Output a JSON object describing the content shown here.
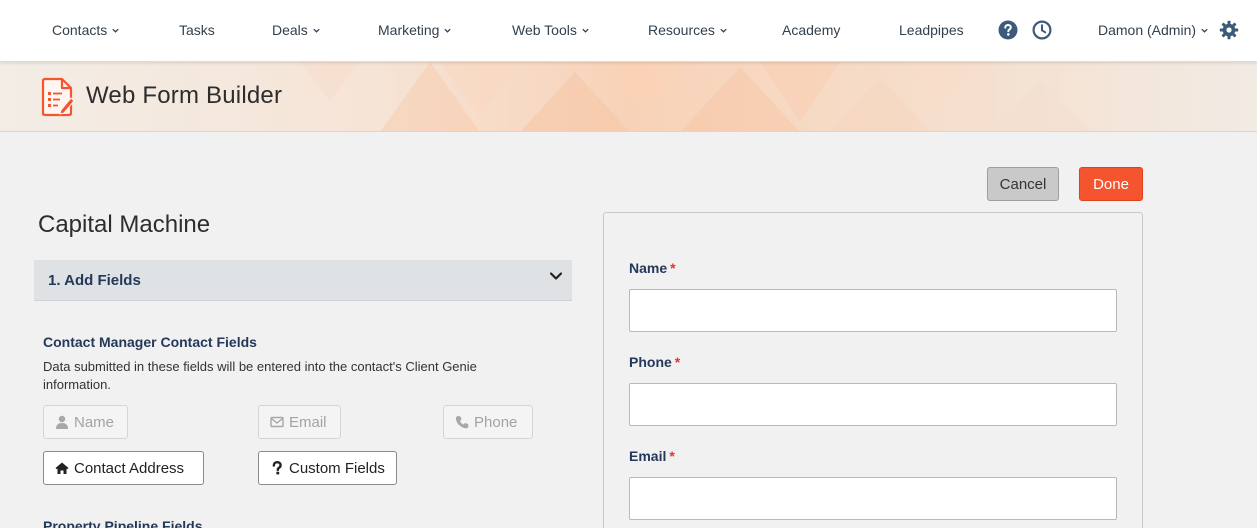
{
  "nav": {
    "items": [
      {
        "label": "Contacts",
        "dropdown": true
      },
      {
        "label": "Tasks",
        "dropdown": false
      },
      {
        "label": "Deals",
        "dropdown": true
      },
      {
        "label": "Marketing",
        "dropdown": true
      },
      {
        "label": "Web Tools",
        "dropdown": true
      },
      {
        "label": "Resources",
        "dropdown": true
      },
      {
        "label": "Academy",
        "dropdown": false
      },
      {
        "label": "Leadpipes",
        "dropdown": false
      }
    ],
    "icons": [
      "help-circle-icon",
      "clock-icon",
      "gear-icon"
    ],
    "user_label": "Damon (Admin)"
  },
  "header": {
    "title": "Web Form Builder",
    "icon": "form-document-icon"
  },
  "actions": {
    "cancel_label": "Cancel",
    "done_label": "Done"
  },
  "builder": {
    "form_name": "Capital Machine",
    "section_label": "1. Add Fields",
    "contact_group": {
      "title": "Contact Manager Contact Fields",
      "description": "Data submitted in these fields will be entered into the contact's Client Genie information.",
      "fields": [
        {
          "label": "Name",
          "icon": "user-icon",
          "enabled": false
        },
        {
          "label": "Email",
          "icon": "envelope-icon",
          "enabled": false
        },
        {
          "label": "Phone",
          "icon": "phone-icon",
          "enabled": false
        },
        {
          "label": "Contact Address",
          "icon": "home-icon",
          "enabled": true
        },
        {
          "label": "Custom Fields",
          "icon": "question-icon",
          "enabled": true
        }
      ]
    },
    "next_group_title": "Property Pipeline Fields"
  },
  "preview": {
    "fields": [
      {
        "label": "Name",
        "required": "*"
      },
      {
        "label": "Phone",
        "required": "*"
      },
      {
        "label": "Email",
        "required": "*"
      }
    ]
  },
  "colors": {
    "accent": "#f4552f",
    "nav_text": "#33404d",
    "heading_navy": "#24395a",
    "required": "#e3342f",
    "icon_blue": "#3e5a7a"
  }
}
